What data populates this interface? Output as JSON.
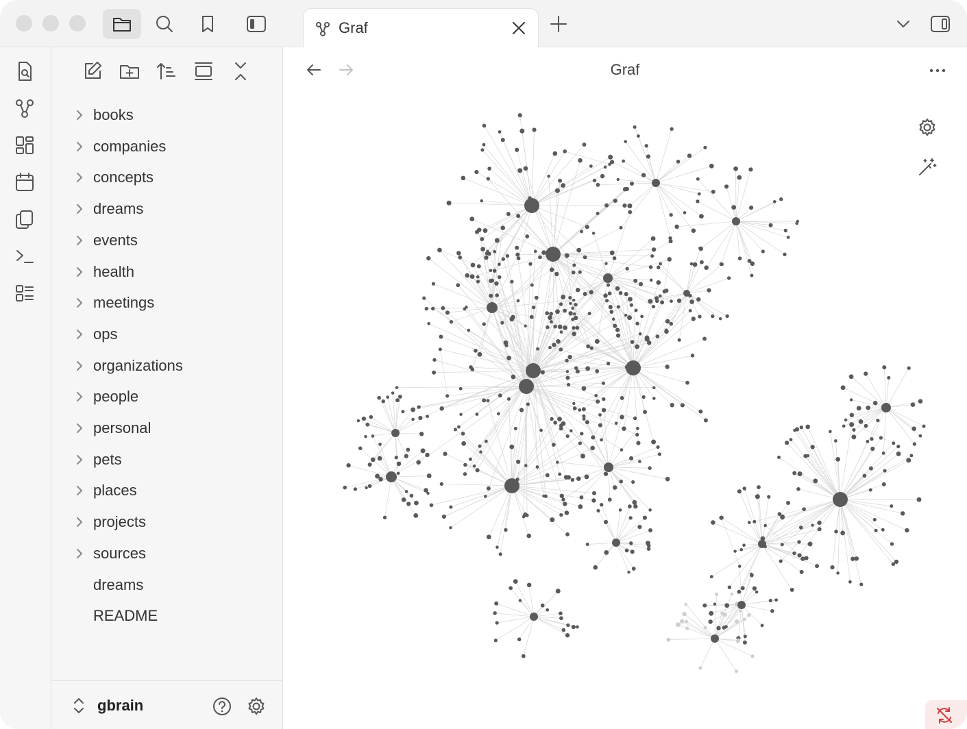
{
  "tab": {
    "title": "Graf"
  },
  "view": {
    "title": "Graf"
  },
  "sidebar": {
    "items": [
      {
        "label": "books",
        "folder": true
      },
      {
        "label": "companies",
        "folder": true
      },
      {
        "label": "concepts",
        "folder": true
      },
      {
        "label": "dreams",
        "folder": true
      },
      {
        "label": "events",
        "folder": true
      },
      {
        "label": "health",
        "folder": true
      },
      {
        "label": "meetings",
        "folder": true
      },
      {
        "label": "ops",
        "folder": true
      },
      {
        "label": "organizations",
        "folder": true
      },
      {
        "label": "people",
        "folder": true
      },
      {
        "label": "personal",
        "folder": true
      },
      {
        "label": "pets",
        "folder": true
      },
      {
        "label": "places",
        "folder": true
      },
      {
        "label": "projects",
        "folder": true
      },
      {
        "label": "sources",
        "folder": true
      },
      {
        "label": "dreams",
        "folder": false
      },
      {
        "label": "README",
        "folder": false
      }
    ]
  },
  "vault": {
    "name": "gbrain"
  },
  "colors": {
    "node": "#5a5a5a",
    "edge": "#dadada",
    "faded_node": "#cfcfcf",
    "sync_error": "#d23c3c"
  },
  "icons": {
    "titlebar": [
      "files-icon",
      "search-icon",
      "bookmark-icon",
      "sidebar-toggle-icon"
    ],
    "ribbon": [
      "quick-switcher-icon",
      "graph-icon",
      "canvas-icon",
      "calendar-icon",
      "templates-icon",
      "terminal-icon",
      "outline-icon"
    ],
    "sidebar_tools": [
      "new-note-icon",
      "new-folder-icon",
      "sort-icon",
      "auto-reveal-icon",
      "collapse-all-icon"
    ],
    "graph_controls": [
      "graph-settings-icon",
      "animate-icon"
    ]
  }
}
